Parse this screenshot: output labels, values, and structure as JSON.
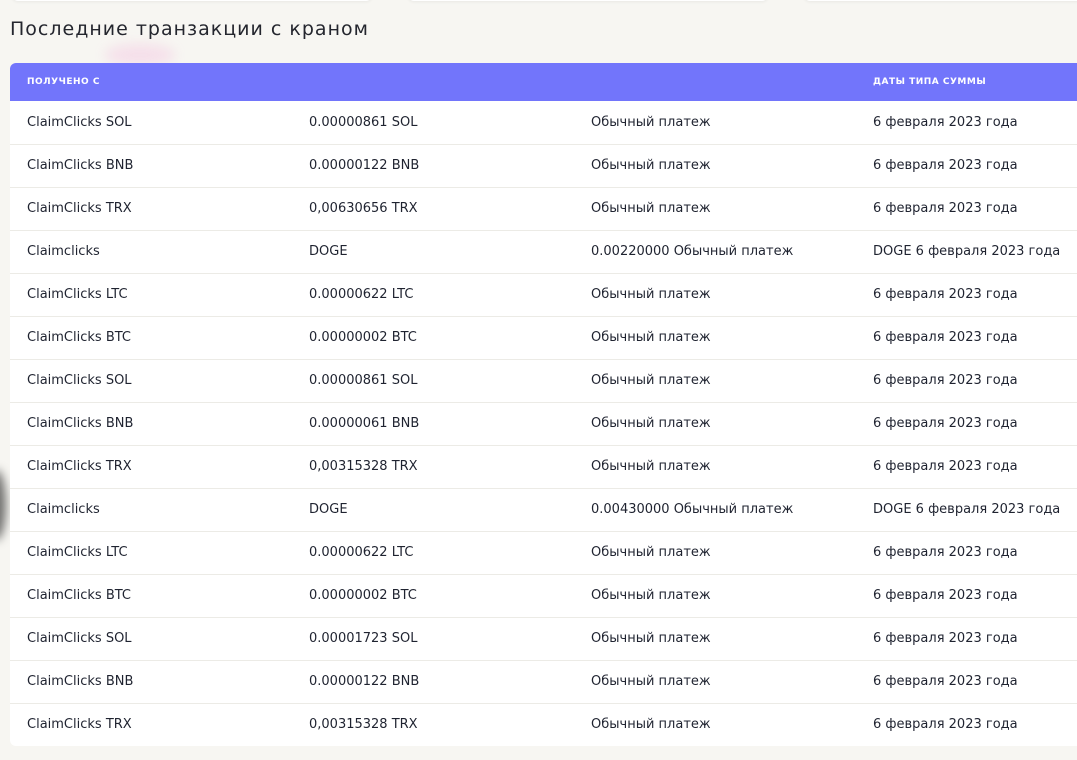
{
  "section_title": "Последние транзакции с краном",
  "table": {
    "headers": [
      "ПОЛУЧЕНО С",
      "",
      "",
      "ДАТЫ ТИПА СУММЫ"
    ],
    "rows": [
      [
        "ClaimClicks SOL",
        "0.00000861 SOL",
        "Обычный платеж",
        "6 февраля 2023 года"
      ],
      [
        "ClaimClicks BNB",
        "0.00000122 BNB",
        "Обычный платеж",
        "6 февраля 2023 года"
      ],
      [
        "ClaimClicks TRX",
        "0,00630656 TRX",
        "Обычный платеж",
        "6 февраля 2023 года"
      ],
      [
        "Claimclicks",
        "DOGE",
        "0.00220000 Обычный платеж",
        "DOGE 6 февраля 2023 года"
      ],
      [
        "ClaimClicks LTC",
        "0.00000622 LTC",
        "Обычный платеж",
        "6 февраля 2023 года"
      ],
      [
        "ClaimClicks BTC",
        "0.00000002 BTC",
        "Обычный платеж",
        "6 февраля 2023 года"
      ],
      [
        "ClaimClicks SOL",
        "0.00000861 SOL",
        "Обычный платеж",
        "6 февраля 2023 года"
      ],
      [
        "ClaimClicks BNB",
        "0.00000061 BNB",
        "Обычный платеж",
        "6 февраля 2023 года"
      ],
      [
        "ClaimClicks TRX",
        "0,00315328 TRX",
        "Обычный платеж",
        "6 февраля 2023 года"
      ],
      [
        "Claimclicks",
        "DOGE",
        "0.00430000 Обычный платеж",
        "DOGE 6 февраля 2023 года"
      ],
      [
        "ClaimClicks LTC",
        "0.00000622 LTC",
        "Обычный платеж",
        "6 февраля 2023 года"
      ],
      [
        "ClaimClicks BTC",
        "0.00000002 BTC",
        "Обычный платеж",
        "6 февраля 2023 года"
      ],
      [
        "ClaimClicks SOL",
        "0.00001723 SOL",
        "Обычный платеж",
        "6 февраля 2023 года"
      ],
      [
        "ClaimClicks BNB",
        "0.00000122 BNB",
        "Обычный платеж",
        "6 февраля 2023 года"
      ],
      [
        "ClaimClicks TRX",
        "0,00315328 TRX",
        "Обычный платеж",
        "6 февраля 2023 года"
      ]
    ]
  },
  "colors": {
    "header_bg": "#7275fb",
    "page_bg": "#f7f6f2",
    "card_bg": "#ffffff"
  }
}
